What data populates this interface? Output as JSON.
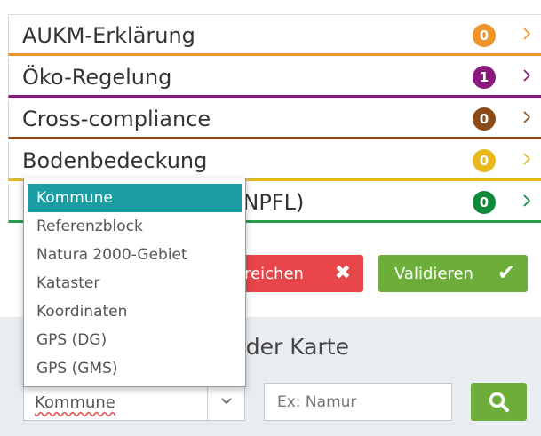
{
  "categories": [
    {
      "label": "AUKM-Erklärung",
      "count": "0",
      "color": "#f0932b",
      "line": "#f0932b"
    },
    {
      "label": "Öko-Regelung",
      "count": "1",
      "color": "#8b1a7e",
      "line": "#8b1a7e"
    },
    {
      "label": "Cross-compliance",
      "count": "0",
      "color": "#8b4a18",
      "line": "#8b4a18"
    },
    {
      "label": "Bodenbedeckung",
      "count": "0",
      "color": "#e7b91e",
      "line": "#e7b91e"
    },
    {
      "label": "(NPFL)",
      "count": "0",
      "color": "#0f8a3a",
      "line": "#2a9e4a"
    }
  ],
  "chevron_icon": "chevron-right-icon",
  "actions": {
    "delete_label": "treichen",
    "validate_label": "Validieren"
  },
  "search_section": {
    "title": "f der Karte",
    "type_value": "Kommune",
    "search_placeholder": "Ex: Namur"
  },
  "dropdown": {
    "options": [
      "Kommune",
      "Referenzblock",
      "Natura 2000-Gebiet",
      "Kataster",
      "Koordinaten",
      "GPS (DG)",
      "GPS (GMS)"
    ],
    "selected": "Kommune"
  },
  "colors": {
    "accent_teal": "#1a9ea4",
    "validate_green": "#6dae3a",
    "delete_red": "#e8454a"
  }
}
